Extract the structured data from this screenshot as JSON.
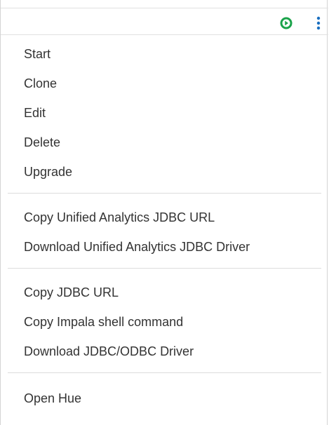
{
  "header": {
    "play_icon": "play-circle-icon",
    "play_color": "#1aa34a",
    "more_icon": "kebab-menu-icon",
    "more_color": "#1a6fc0"
  },
  "menu": {
    "groups": [
      {
        "items": [
          {
            "label": "Start"
          },
          {
            "label": "Clone"
          },
          {
            "label": "Edit"
          },
          {
            "label": "Delete"
          },
          {
            "label": "Upgrade"
          }
        ]
      },
      {
        "items": [
          {
            "label": "Copy Unified Analytics JDBC URL"
          },
          {
            "label": "Download Unified Analytics JDBC Driver"
          }
        ]
      },
      {
        "items": [
          {
            "label": "Copy JDBC URL"
          },
          {
            "label": "Copy Impala shell command"
          },
          {
            "label": "Download JDBC/ODBC Driver"
          }
        ]
      },
      {
        "items": [
          {
            "label": "Open Hue"
          }
        ]
      }
    ]
  }
}
